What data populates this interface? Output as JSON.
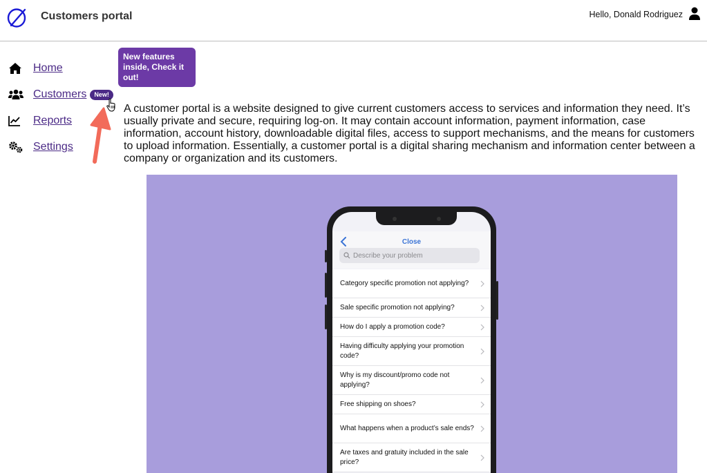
{
  "header": {
    "app_title": "Customers portal",
    "greeting": "Hello, Donald Rodriguez",
    "logo_icon": "brand-logo-icon",
    "user_icon": "user-icon"
  },
  "sidebar": {
    "items": [
      {
        "label": "Home",
        "icon": "home-icon"
      },
      {
        "label": "Customers",
        "icon": "users-icon",
        "badge": "New!"
      },
      {
        "label": "Reports",
        "icon": "chart-line-icon"
      },
      {
        "label": "Settings",
        "icon": "gears-icon"
      }
    ]
  },
  "tooltip": {
    "text": "New features inside, Check it out!"
  },
  "main": {
    "description": "A customer portal is a website designed to give current customers access to services and information they need. It’s usually private and secure, requiring log-on. It may contain account information, payment information, case information, account history, downloadable digital files, access to support mechanisms, and the means for customers to upload information. Essentially, a customer portal is a digital sharing mechanism and information center between a company or organization and its customers."
  },
  "phone": {
    "close_label": "Close",
    "search_placeholder": "Describe your problem",
    "faq": [
      "Category specific promotion not applying?",
      "Sale specific promotion not applying?",
      "How do I apply a promotion code?",
      "Having difficulty applying your promotion code?",
      "Why is my discount/promo code not applying?",
      "Free shipping on shoes?",
      "What happens when a product’s sale ends?",
      "Are taxes and gratuity included in the sale price?"
    ]
  },
  "colors": {
    "accent": "#4b2a86",
    "tooltip_bg": "#6c3aa6",
    "hero_bg": "#a89ddc",
    "annotation_arrow": "#f26b5a",
    "link_blue": "#3b74d6"
  }
}
